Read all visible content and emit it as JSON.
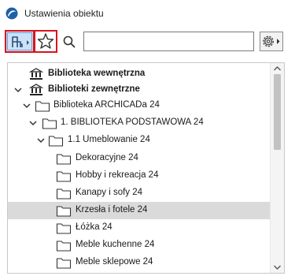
{
  "window": {
    "title": "Ustawienia obiektu"
  },
  "toolbar": {
    "search_value": "",
    "search_placeholder": ""
  },
  "tree": {
    "items": [
      {
        "label": "Biblioteka wewnętrzna",
        "bold": true,
        "icon": "library-icon",
        "expanded": null,
        "selected": false
      },
      {
        "label": "Biblioteki zewnętrzne",
        "bold": true,
        "icon": "library-icon",
        "expanded": true,
        "selected": false
      },
      {
        "label": "Biblioteka ARCHICADa 24",
        "bold": false,
        "icon": "folder-icon",
        "expanded": true,
        "selected": false
      },
      {
        "label": "1. BIBLIOTEKA PODSTAWOWA 24",
        "bold": false,
        "icon": "folder-icon",
        "expanded": true,
        "selected": false
      },
      {
        "label": "1.1 Umeblowanie 24",
        "bold": false,
        "icon": "folder-icon",
        "expanded": true,
        "selected": false
      },
      {
        "label": "Dekoracyjne 24",
        "bold": false,
        "icon": "folder-icon",
        "expanded": null,
        "selected": false
      },
      {
        "label": "Hobby i rekreacja 24",
        "bold": false,
        "icon": "folder-icon",
        "expanded": null,
        "selected": false
      },
      {
        "label": "Kanapy i sofy 24",
        "bold": false,
        "icon": "folder-icon",
        "expanded": null,
        "selected": false
      },
      {
        "label": "Krzesła i fotele 24",
        "bold": false,
        "icon": "folder-icon",
        "expanded": null,
        "selected": true
      },
      {
        "label": "Łóżka 24",
        "bold": false,
        "icon": "folder-icon",
        "expanded": null,
        "selected": false
      },
      {
        "label": "Meble kuchenne 24",
        "bold": false,
        "icon": "folder-icon",
        "expanded": null,
        "selected": false
      },
      {
        "label": "Meble sklepowe 24",
        "bold": false,
        "icon": "folder-icon",
        "expanded": null,
        "selected": false
      }
    ]
  },
  "colors": {
    "highlight_border": "#d9141e",
    "selected_row": "#dadada",
    "active_button": "#cde2f6"
  }
}
